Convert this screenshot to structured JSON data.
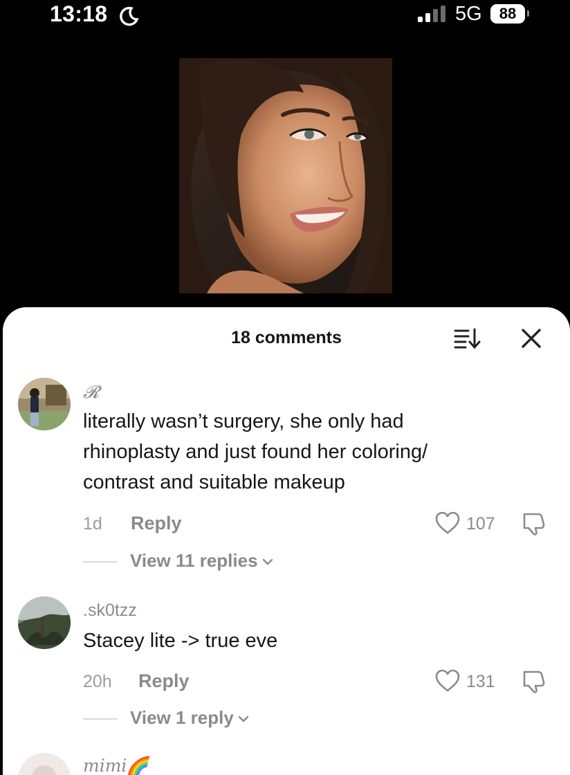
{
  "status_bar": {
    "time": "13:18",
    "network": "5G",
    "battery": "88"
  },
  "video": {
    "icon": "portrait-image"
  },
  "comments_sheet": {
    "title": "18 comments",
    "comments": [
      {
        "username": "𝓡",
        "text_lines": [
          "literally wasn’t surgery, she only had",
          "rhinoplasty and just found her coloring/",
          "contrast and suitable makeup"
        ],
        "time": "1d",
        "reply": "Reply",
        "likes": "107",
        "view_replies": "View 11 replies"
      },
      {
        "username": ".sk0tzz",
        "text_lines": [
          "Stacey lite -> true eve"
        ],
        "time": "20h",
        "reply": "Reply",
        "likes": "131",
        "view_replies": "View 1 reply"
      },
      {
        "username": "mimi🌈"
      }
    ]
  }
}
